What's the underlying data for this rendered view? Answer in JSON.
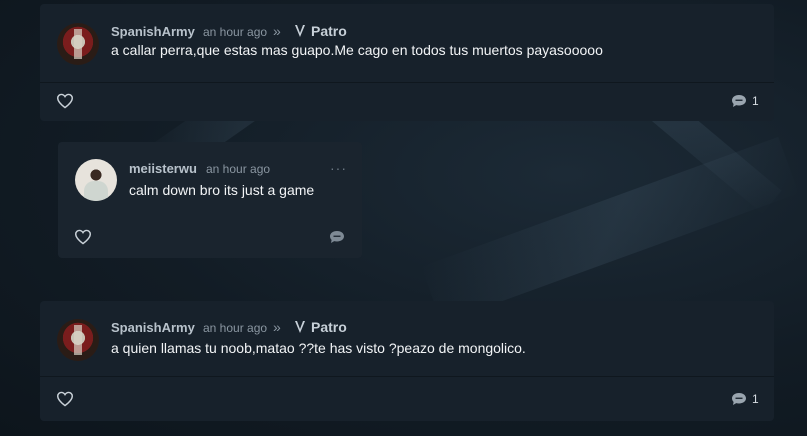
{
  "posts": [
    {
      "username": "SpanishArmy",
      "time": "an hour ago",
      "target": "Patro",
      "text": "a callar perra,que estas mas guapo.Me cago en todos tus muertos payasooooo",
      "comment_count": "1"
    },
    {
      "username": "SpanishArmy",
      "time": "an hour ago",
      "target": "Patro",
      "text": "a quien llamas tu noob,matao ??te has visto ?peazo de mongolico.",
      "comment_count": "1"
    }
  ],
  "reply": {
    "username": "meiisterwu",
    "time": "an hour ago",
    "text": "calm down bro its just a game",
    "menu": "···"
  },
  "icons": {
    "like": "heart-icon",
    "comment": "comment-bubble-icon",
    "separator": "double-chevron-right-icon",
    "target": "game-emblem-icon"
  },
  "colors": {
    "card": "#17212b",
    "reply_card": "#1a242e",
    "username": "#b8c2cb",
    "text": "#f2f4f6",
    "muted": "#8a96a1"
  }
}
